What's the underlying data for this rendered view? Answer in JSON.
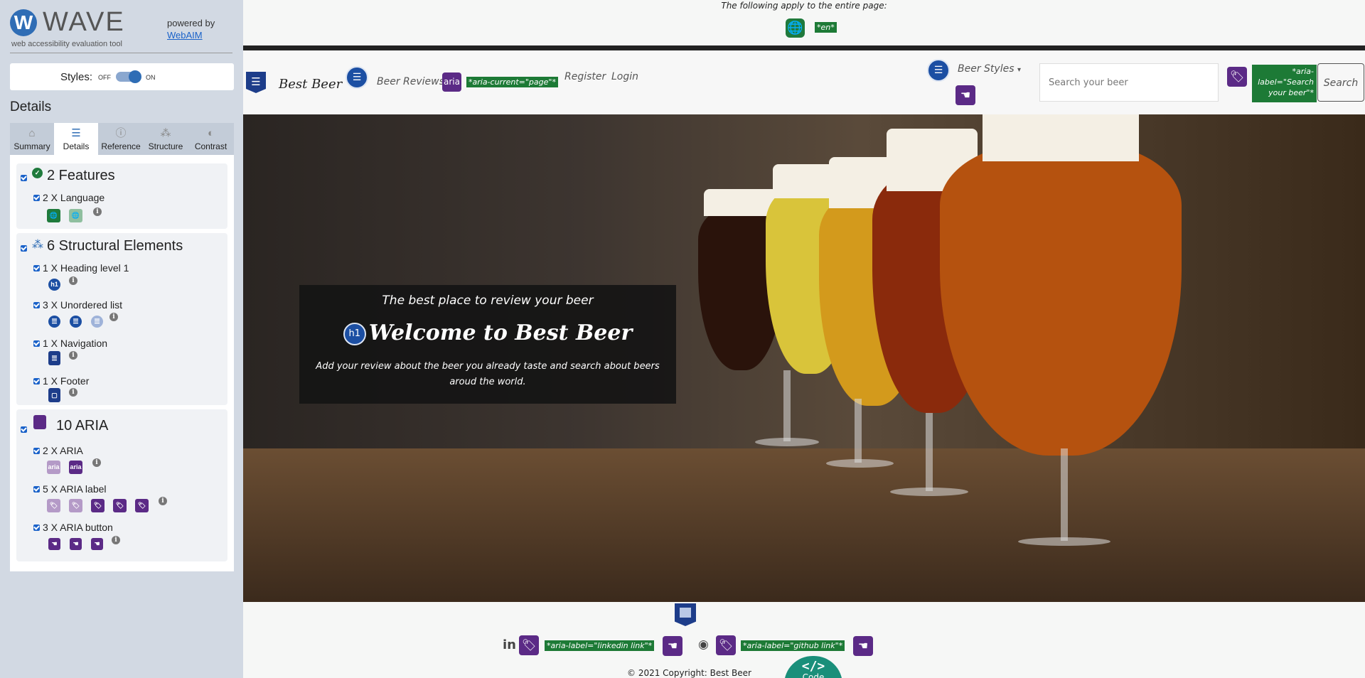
{
  "wave": {
    "logo": "WAVE",
    "logo_sub": "web accessibility evaluation tool",
    "powered_by": "powered by",
    "webaim": "WebAIM",
    "styles_label": "Styles:",
    "styles_off": "OFF",
    "styles_on": "ON",
    "details_heading": "Details",
    "tabs": [
      {
        "label": "Summary",
        "icon": "home-icon"
      },
      {
        "label": "Details",
        "icon": "list-icon",
        "active": true
      },
      {
        "label": "Reference",
        "icon": "info-icon"
      },
      {
        "label": "Structure",
        "icon": "structure-icon"
      },
      {
        "label": "Contrast",
        "icon": "contrast-icon"
      }
    ],
    "groups": {
      "features": {
        "title": "2 Features",
        "items": [
          {
            "label": "2 X Language"
          }
        ]
      },
      "structural": {
        "title": "6 Structural Elements",
        "items": [
          {
            "label": "1 X Heading level 1"
          },
          {
            "label": "3 X Unordered list"
          },
          {
            "label": "1 X Navigation"
          },
          {
            "label": "1 X Footer"
          }
        ]
      },
      "aria": {
        "title": "10 ARIA",
        "items": [
          {
            "label": "2 X ARIA",
            "icon_text": "aria"
          },
          {
            "label": "5 X ARIA label"
          },
          {
            "label": "3 X ARIA button"
          }
        ]
      }
    }
  },
  "page": {
    "apply_note": "The following apply to the entire page:",
    "lang_tag": "*en*",
    "brand": "Best Beer",
    "nav": {
      "reviews": "Beer Reviews",
      "aria_badge": "aria",
      "aria_current_tag": "*aria-current=\"page\"*",
      "register": "Register",
      "login": "Login",
      "beer_styles": "Beer Styles"
    },
    "search": {
      "placeholder": "Search your beer",
      "aria_label_tag": "*aria-label=\"Search your beer\"*",
      "button": "Search"
    },
    "hero": {
      "subtitle": "The best place to review your beer",
      "h1_icon": "h1",
      "title": "Welcome to Best Beer",
      "description": "Add your review about the beer you already taste and search about beers aroud the world."
    },
    "footer": {
      "linkedin_glyph": "in",
      "linkedin_tag": "*aria-label=\"linkedin link\"*",
      "github_tag": "*aria-label=\"github link\"*",
      "copyright": "© 2021 Copyright: Best Beer",
      "code_symbol": "</>",
      "code_label": "Code"
    }
  },
  "colors": {
    "wave_bg": "#d2d9e3",
    "feature_green": "#1f7a3c",
    "structure_blue": "#1c4fa3",
    "aria_purple": "#5b2a86",
    "tag_green": "#1d7a36"
  }
}
